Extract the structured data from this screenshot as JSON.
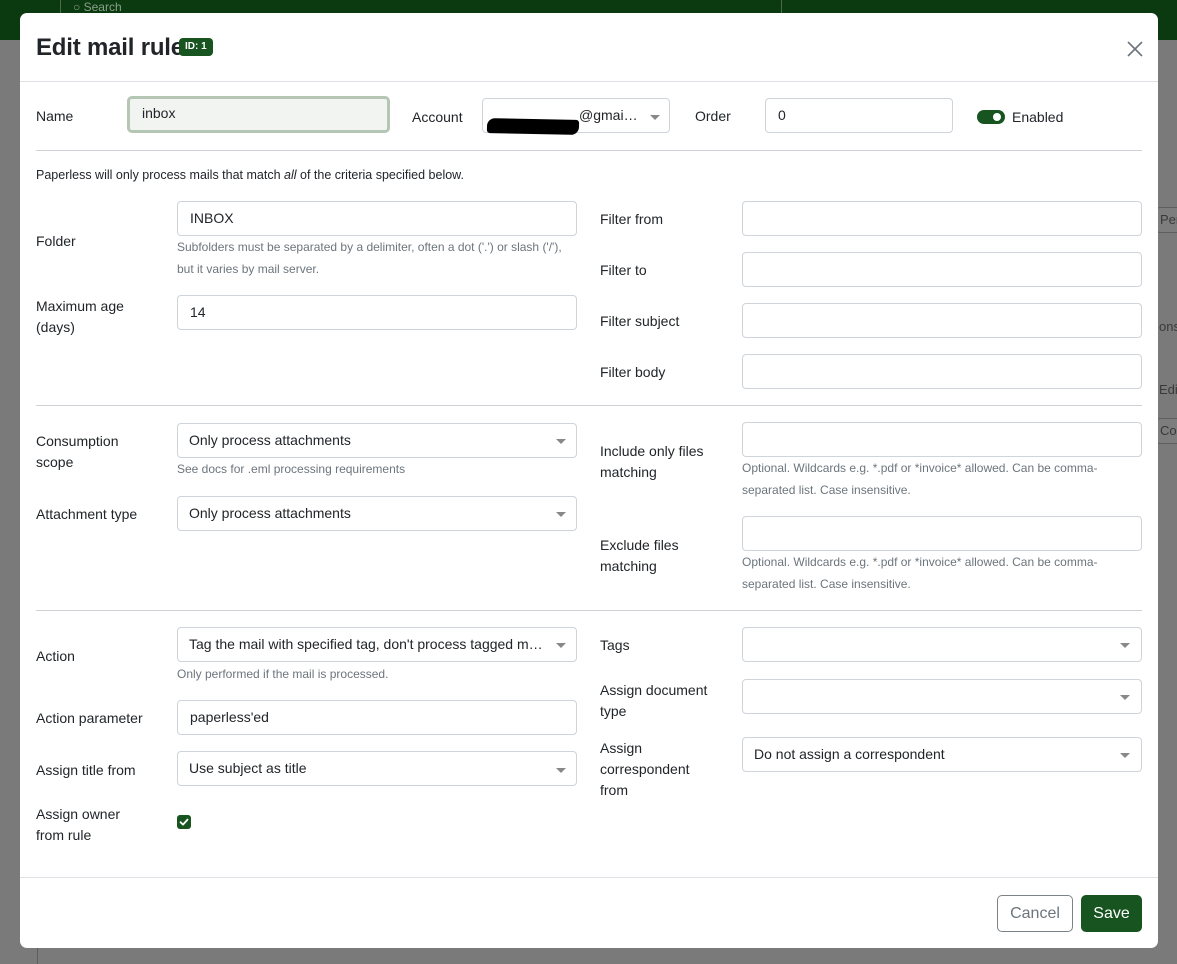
{
  "background": {
    "search_placeholder": "Search",
    "fragments": [
      "Per",
      "ons",
      "Edit",
      "Co"
    ]
  },
  "modal": {
    "title": "Edit mail rule",
    "id_badge": "ID: 1",
    "close_icon": "close-icon"
  },
  "fields": {
    "name_label": "Name",
    "name_value": "inbox",
    "account_label": "Account",
    "account_value": "@gmail.c...",
    "order_label": "Order",
    "order_value": "0",
    "enabled_label": "Enabled",
    "enabled": true,
    "intro_prefix": "Paperless will only process mails that match ",
    "intro_em": "all",
    "intro_suffix": " of the criteria specified below.",
    "folder_label": "Folder",
    "folder_value": "INBOX",
    "folder_help": "Subfolders must be separated by a delimiter, often a dot ('.') or slash ('/'), but it varies by mail server.",
    "max_age_label": "Maximum age (days)",
    "max_age_value": "14",
    "filter_from_label": "Filter from",
    "filter_to_label": "Filter to",
    "filter_subject_label": "Filter subject",
    "filter_body_label": "Filter body",
    "consumption_scope_label": "Consumption scope",
    "consumption_scope_value": "Only process attachments",
    "consumption_scope_help": "See docs for .eml processing requirements",
    "attachment_type_label": "Attachment type",
    "attachment_type_value": "Only process attachments",
    "include_files_label": "Include only files matching",
    "include_files_help": "Optional. Wildcards e.g. *.pdf or *invoice* allowed. Can be comma-separated list. Case insensitive.",
    "exclude_files_label": "Exclude files matching",
    "exclude_files_help": "Optional. Wildcards e.g. *.pdf or *invoice* allowed. Can be comma-separated list. Case insensitive.",
    "action_label": "Action",
    "action_value": "Tag the mail with specified tag, don't process tagged mails",
    "action_help": "Only performed if the mail is processed.",
    "action_parameter_label": "Action parameter",
    "action_parameter_value": "paperless'ed",
    "assign_title_label": "Assign title from",
    "assign_title_value": "Use subject as title",
    "assign_owner_label": "Assign owner from rule",
    "assign_owner_checked": true,
    "tags_label": "Tags",
    "doc_type_label": "Assign document type",
    "correspondent_label": "Assign correspondent from",
    "correspondent_value": "Do not assign a correspondent"
  },
  "footer": {
    "cancel_label": "Cancel",
    "save_label": "Save"
  },
  "colors": {
    "accent": "#17541f"
  }
}
